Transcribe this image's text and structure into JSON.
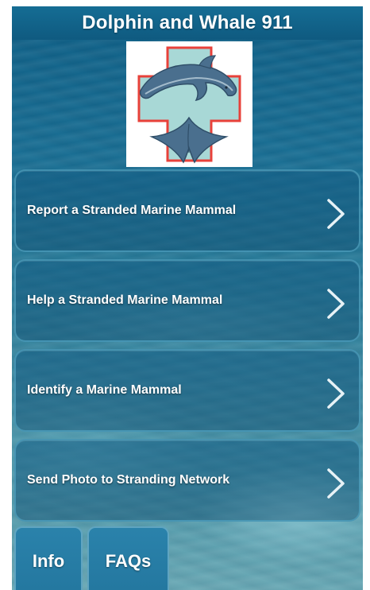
{
  "app": {
    "title": "Dolphin and Whale 911"
  },
  "logo": {
    "icon": "dolphin-whale-tail-cross-logo",
    "colors": {
      "cross_fill": "#a8d8d6",
      "cross_border": "#e8413a",
      "animal": "#4a6f8e"
    }
  },
  "menu": {
    "items": [
      {
        "label": "Report a Stranded Marine Mammal",
        "icon": "chevron-right-icon"
      },
      {
        "label": "Help a Stranded Marine Mammal",
        "icon": "chevron-right-icon"
      },
      {
        "label": "Identify a Marine Mammal",
        "icon": "chevron-right-icon"
      },
      {
        "label": "Send Photo to Stranding Network",
        "icon": "chevron-right-icon"
      }
    ]
  },
  "tabs": [
    {
      "label": "Info"
    },
    {
      "label": "FAQs"
    }
  ],
  "colors": {
    "title_bar": "#156d94",
    "button_border": "#50a0be",
    "tab_bg": "#2a82ab"
  }
}
